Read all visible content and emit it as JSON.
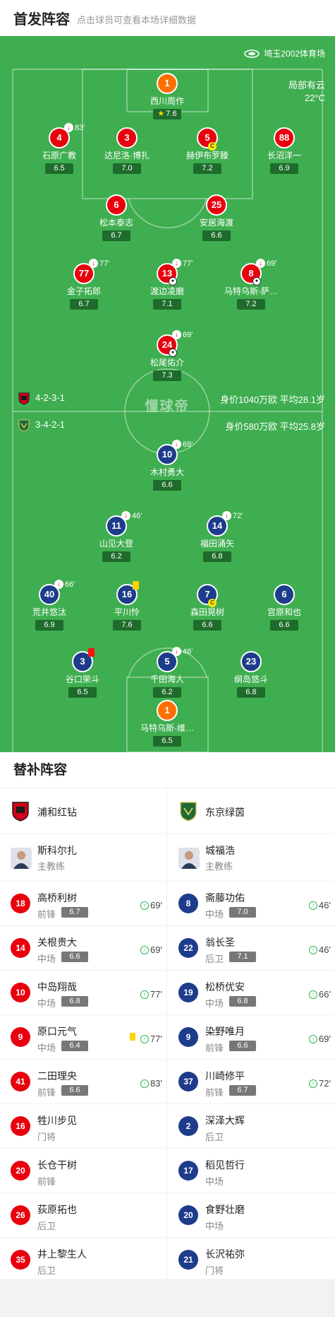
{
  "header": {
    "title": "首发阵容",
    "subtitle": "点击球员可查看本场详细数据"
  },
  "venue": {
    "name": "埼玉2002体育场",
    "weather": "局部有云",
    "temperature": "22°C"
  },
  "watermark": "懂球帝",
  "home_team": {
    "formation": "4-2-3-1",
    "value": "身价1040万欧  平均28.1岁"
  },
  "away_team": {
    "formation": "3-4-2-1",
    "value": "身价580万欧  平均25.8岁"
  },
  "home_lineup": [
    {
      "num": "1",
      "name": "西川周作",
      "rating": "7.6",
      "gk": true,
      "star": true
    },
    {
      "num": "4",
      "name": "石原广教",
      "rating": "6.5",
      "sub": "83'"
    },
    {
      "num": "3",
      "name": "达尼洛·博扎",
      "rating": "7.0"
    },
    {
      "num": "5",
      "name": "赫伊布罗滕",
      "rating": "7.2",
      "captain": true
    },
    {
      "num": "88",
      "name": "长沼洋一",
      "rating": "6.9"
    },
    {
      "num": "6",
      "name": "松本泰志",
      "rating": "6.7"
    },
    {
      "num": "25",
      "name": "安居海渡",
      "rating": "6.6"
    },
    {
      "num": "77",
      "name": "金子拓郎",
      "rating": "6.7",
      "sub": "77'"
    },
    {
      "num": "13",
      "name": "渡边凌磨",
      "rating": "7.1",
      "sub": "77'",
      "goal": true
    },
    {
      "num": "8",
      "name": "马特乌斯-萨…",
      "rating": "7.2",
      "sub": "69'",
      "goal": true
    },
    {
      "num": "24",
      "name": "松尾佑介",
      "rating": "7.3",
      "sub": "69'",
      "goal": true
    }
  ],
  "away_lineup": [
    {
      "num": "10",
      "name": "木村勇大",
      "rating": "6.6",
      "sub": "69'"
    },
    {
      "num": "11",
      "name": "山见大登",
      "rating": "6.2",
      "sub": "46'"
    },
    {
      "num": "14",
      "name": "福田涌矢",
      "rating": "6.8",
      "sub": "72'"
    },
    {
      "num": "40",
      "name": "荒井悠汰",
      "rating": "6.9",
      "sub": "66'"
    },
    {
      "num": "16",
      "name": "平川怜",
      "rating": "7.6",
      "card": "yellow"
    },
    {
      "num": "7",
      "name": "森田晃树",
      "rating": "6.6",
      "captain": true
    },
    {
      "num": "6",
      "name": "宫原和也",
      "rating": "6.6"
    },
    {
      "num": "3",
      "name": "谷口荣斗",
      "rating": "6.5",
      "card": "red"
    },
    {
      "num": "5",
      "name": "千田海人",
      "rating": "6.2",
      "sub": "46'"
    },
    {
      "num": "23",
      "name": "纲岛悠斗",
      "rating": "6.8"
    },
    {
      "num": "1",
      "name": "马特乌斯-维…",
      "rating": "6.5",
      "gk": true
    }
  ],
  "subs": {
    "title": "替补阵容",
    "home": {
      "team": "浦和红钻",
      "coach": {
        "name": "斯科尔扎",
        "role": "主教练"
      },
      "players": [
        {
          "num": "18",
          "name": "高桥利树",
          "pos": "前锋",
          "rating": "6.7",
          "in": "69'"
        },
        {
          "num": "14",
          "name": "关根贵大",
          "pos": "中场",
          "rating": "6.6",
          "in": "69'"
        },
        {
          "num": "10",
          "name": "中岛翔哉",
          "pos": "中场",
          "rating": "6.8",
          "in": "77'"
        },
        {
          "num": "9",
          "name": "原口元气",
          "pos": "中场",
          "rating": "6.4",
          "in": "77'",
          "yellow": true
        },
        {
          "num": "41",
          "name": "二田理央",
          "pos": "前锋",
          "rating": "6.6",
          "in": "83'"
        },
        {
          "num": "16",
          "name": "牲川步见",
          "pos": "门将"
        },
        {
          "num": "20",
          "name": "长仓干树",
          "pos": "前锋"
        },
        {
          "num": "26",
          "name": "荻原拓也",
          "pos": "后卫"
        },
        {
          "num": "35",
          "name": "井上黎生人",
          "pos": "后卫"
        }
      ]
    },
    "away": {
      "team": "东京绿茵",
      "coach": {
        "name": "城福浩",
        "role": "主教练"
      },
      "players": [
        {
          "num": "8",
          "name": "斋藤功佑",
          "pos": "中场",
          "rating": "7.0",
          "in": "46'"
        },
        {
          "num": "22",
          "name": "翁长圣",
          "pos": "后卫",
          "rating": "7.1",
          "in": "46'"
        },
        {
          "num": "19",
          "name": "松桥优安",
          "pos": "中场",
          "rating": "6.8",
          "in": "66'"
        },
        {
          "num": "9",
          "name": "染野唯月",
          "pos": "前锋",
          "rating": "6.6",
          "in": "69'"
        },
        {
          "num": "37",
          "name": "川崎修平",
          "pos": "前锋",
          "rating": "6.7",
          "in": "72'"
        },
        {
          "num": "2",
          "name": "深泽大辉",
          "pos": "后卫"
        },
        {
          "num": "17",
          "name": "稻见哲行",
          "pos": "中场"
        },
        {
          "num": "20",
          "name": "食野壮磨",
          "pos": "中场"
        },
        {
          "num": "21",
          "name": "长沢祐弥",
          "pos": "门将"
        }
      ]
    }
  },
  "colors": {
    "home": "#e8000e",
    "away": "#1e3c8c",
    "gk": "#ff6f00",
    "pitch": "#3fae50"
  }
}
